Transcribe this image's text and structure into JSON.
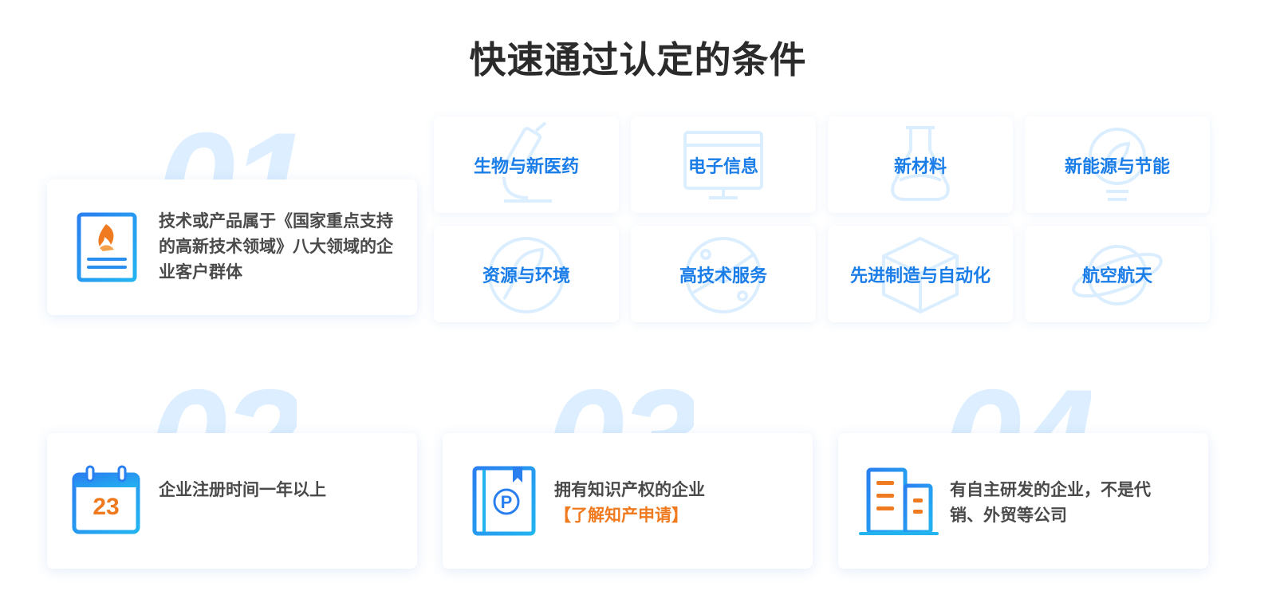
{
  "title": "快速通过认定的条件",
  "numbers": [
    "01",
    "02",
    "03",
    "04"
  ],
  "conditions": [
    {
      "text": "技术或产品属于《国家重点支持的高新技术领域》八大领域的企业客户群体",
      "icon": "document-flame-icon"
    },
    {
      "text": "企业注册时间一年以上",
      "icon": "calendar-icon",
      "calendar_day": "23"
    },
    {
      "text": "拥有知识产权的企业",
      "link": "【了解知产申请】",
      "icon": "patent-book-icon"
    },
    {
      "text": "有自主研发的企业，不是代销、外贸等公司",
      "icon": "building-icon"
    }
  ],
  "fields": [
    {
      "label": "生物与新医药",
      "icon": "microscope-icon"
    },
    {
      "label": "电子信息",
      "icon": "monitor-icon"
    },
    {
      "label": "新材料",
      "icon": "flask-icon"
    },
    {
      "label": "新能源与节能",
      "icon": "bulb-leaf-icon"
    },
    {
      "label": "资源与环境",
      "icon": "globe-leaf-icon"
    },
    {
      "label": "高技术服务",
      "icon": "orbit-icon"
    },
    {
      "label": "先进制造与自动化",
      "icon": "box-icon"
    },
    {
      "label": "航空航天",
      "icon": "planet-icon"
    }
  ],
  "colors": {
    "title": "#2b2b2b",
    "body_text": "#4a4a4a",
    "field_label": "#1a7de8",
    "accent_orange": "#f07a1f",
    "big_number": "#dceeff",
    "icon_blue": "#1e88e5"
  }
}
